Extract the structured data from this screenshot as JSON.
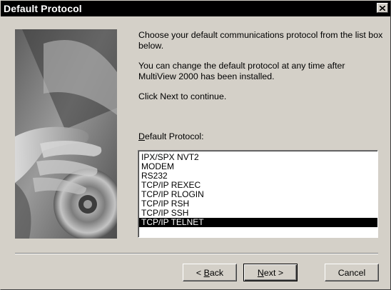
{
  "window": {
    "title": "Default Protocol"
  },
  "content": {
    "intro": "Choose your default communications protocol from the list box below.",
    "change_note": "You can change the default protocol at any time after MultiView 2000 has been installed.",
    "continue_note": "Click Next to continue.",
    "list_label_accel": "D",
    "list_label_rest": "efault Protocol:"
  },
  "protocols": [
    "IPX/SPX NVT2",
    "MODEM",
    "RS232",
    "TCP/IP REXEC",
    "TCP/IP RLOGIN",
    "TCP/IP RSH",
    "TCP/IP SSH",
    "TCP/IP TELNET"
  ],
  "selected_protocol": "TCP/IP TELNET",
  "buttons": {
    "back_prefix": "< ",
    "back_accel": "B",
    "back_rest": "ack",
    "next_accel": "N",
    "next_rest": "ext >",
    "cancel": "Cancel"
  },
  "icons": {
    "close": "close-icon",
    "artwork": "setup-artwork-compact-disc-hand"
  }
}
